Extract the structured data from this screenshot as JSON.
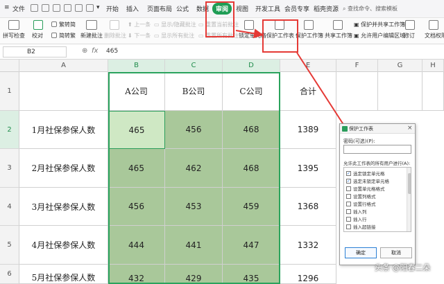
{
  "menubar": {
    "file_label": "文件",
    "tabs": [
      "开始",
      "插入",
      "页面布局",
      "公式",
      "数据",
      "审阅",
      "视图",
      "开发工具",
      "会员专享",
      "稻壳资源"
    ],
    "active_tab": "审阅",
    "search_placeholder": "查找命令、搜索模板"
  },
  "ribbon": {
    "spell_check": "拼写检查",
    "proofread": "校对",
    "trad_to_simp": "繁转简",
    "simp_to_trad": "简转繁",
    "new_comment": "新建批注",
    "delete_comment": "删除批注",
    "prev_comment": "上一条",
    "next_comment": "下一条",
    "show_hide_comment": "显示/隐藏批注",
    "show_all_comments": "显示所有批注",
    "reset_comment": "重置当前批注",
    "reset_all_comments": "重置所有批注",
    "lock_cell": "锁定单元格",
    "protect_sheet": "保护工作表",
    "protect_workbook": "保护工作簿",
    "share_workbook": "共享工作簿",
    "protect_and_share": "保护并共享工作簿",
    "allow_edit_ranges": "允许用户编辑区域",
    "revisions": "修订",
    "doc_permissions": "文档权限"
  },
  "formula_bar": {
    "cell_ref": "B2",
    "fx": "fx",
    "value": "465"
  },
  "sheet": {
    "columns": [
      "A",
      "B",
      "C",
      "D",
      "E",
      "F",
      "G",
      "H"
    ],
    "rows": [
      "1",
      "2",
      "3",
      "4",
      "5",
      "6"
    ],
    "header_row": [
      "",
      "A公司",
      "B公司",
      "C公司",
      "合计"
    ],
    "data": [
      {
        "label": "1月社保参保人数",
        "a": "465",
        "b": "456",
        "c": "468",
        "total": "1389"
      },
      {
        "label": "2月社保参保人数",
        "a": "465",
        "b": "462",
        "c": "468",
        "total": "1395"
      },
      {
        "label": "3月社保参保人数",
        "a": "456",
        "b": "453",
        "c": "459",
        "total": "1368"
      },
      {
        "label": "4月社保参保人数",
        "a": "444",
        "b": "441",
        "c": "447",
        "total": "1332"
      },
      {
        "label": "5月社保参保人数",
        "a": "432",
        "b": "429",
        "c": "435",
        "total": "1296"
      }
    ]
  },
  "dialog": {
    "title": "保护工作表",
    "password_label": "密码(可选)(P):",
    "password_value": "",
    "allow_label": "允许此工作表的所有用户进行(A):",
    "permissions": [
      {
        "label": "选定锁定单元格",
        "checked": true
      },
      {
        "label": "选定未锁定单元格",
        "checked": true
      },
      {
        "label": "设置单元格格式",
        "checked": false
      },
      {
        "label": "设置列格式",
        "checked": false
      },
      {
        "label": "设置行格式",
        "checked": false
      },
      {
        "label": "插入列",
        "checked": false
      },
      {
        "label": "插入行",
        "checked": false
      },
      {
        "label": "插入超链接",
        "checked": false
      }
    ],
    "ok_label": "确定",
    "cancel_label": "取消",
    "close_label": "×"
  },
  "watermark": "头条 @阳春二朵",
  "colors": {
    "accent_green": "#1f9d55",
    "selection_fill": "#a9c89a",
    "annotation_red": "#e53935"
  }
}
